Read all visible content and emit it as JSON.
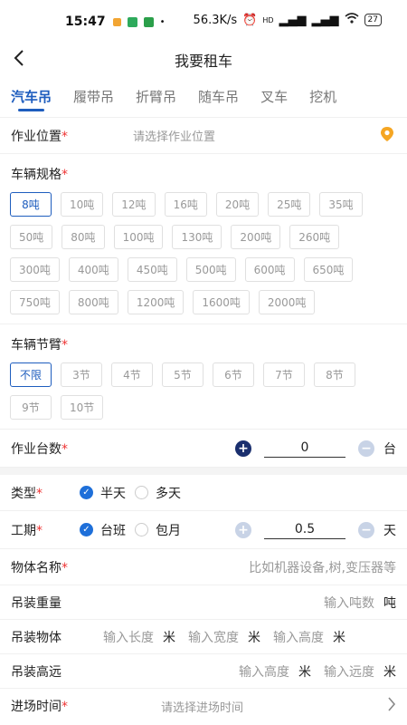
{
  "status": {
    "time": "15:47",
    "speed": "56.3K/s",
    "network": "HD",
    "battery": "27"
  },
  "nav": {
    "title": "我要租车",
    "back_icon": "chevron-left-icon"
  },
  "tabs": [
    "汽车吊",
    "履带吊",
    "折臂吊",
    "随车吊",
    "叉车",
    "挖机"
  ],
  "location": {
    "label": "作业位置",
    "placeholder": "请选择作业位置",
    "icon_color": "#f5a623"
  },
  "spec": {
    "label": "车辆规格",
    "options": [
      "8吨",
      "10吨",
      "12吨",
      "16吨",
      "20吨",
      "25吨",
      "35吨",
      "50吨",
      "80吨",
      "100吨",
      "130吨",
      "200吨",
      "260吨",
      "300吨",
      "400吨",
      "450吨",
      "500吨",
      "600吨",
      "650吨",
      "750吨",
      "800吨",
      "1200吨",
      "1600吨",
      "2000吨"
    ],
    "selected": "8吨"
  },
  "arm": {
    "label": "车辆节臂",
    "options": [
      "不限",
      "3节",
      "4节",
      "5节",
      "6节",
      "7节",
      "8节",
      "9节",
      "10节"
    ],
    "selected": "不限"
  },
  "count": {
    "label": "作业台数",
    "value": "0",
    "unit": "台",
    "plus": "+",
    "minus": "−"
  },
  "type": {
    "label": "类型",
    "options": [
      "半天",
      "多天"
    ],
    "selected": "半天"
  },
  "period": {
    "label": "工期",
    "options": [
      "台班",
      "包月"
    ],
    "selected": "台班",
    "value": "0.5",
    "unit": "天",
    "plus": "+",
    "minus": "−"
  },
  "object_name": {
    "label": "物体名称",
    "placeholder": "比如机器设备,树,变压器等"
  },
  "weight": {
    "label": "吊装重量",
    "placeholder": "输入吨数",
    "unit": "吨"
  },
  "object_dims": {
    "label": "吊装物体",
    "length": "输入长度",
    "width": "输入宽度",
    "height": "输入高度",
    "unit": "米"
  },
  "lift_height": {
    "label": "吊装高远",
    "height": "输入高度",
    "distance": "输入远度",
    "unit": "米"
  },
  "entry_time": {
    "label": "进场时间",
    "placeholder": "请选择进场时间"
  },
  "colors": {
    "accent": "#1e5dbe",
    "required": "#e33333"
  }
}
